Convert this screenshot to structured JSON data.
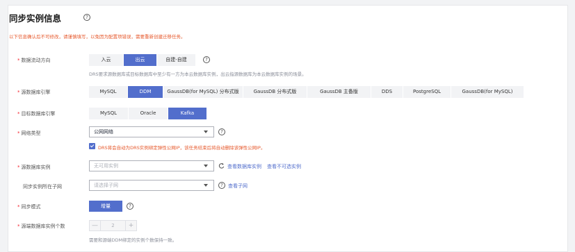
{
  "page": {
    "title": "同步实例信息",
    "warning": "以下信息确认后不可修改，请谨慎填写，以免因为配置项错误，需要重新创建迁移任务。"
  },
  "flow_direction": {
    "label": "数据流动方向",
    "options": [
      "入云",
      "出云",
      "自建-自建"
    ],
    "selected": "出云",
    "hint": "DRS要求源数据库或目标数据库中至少有一方为本云数据库实例，出云指源数据库为本云数据库实例的场景。"
  },
  "source_engine": {
    "label": "源数据库引擎",
    "options": [
      "MySQL",
      "DDM",
      "GaussDB(for MySQL) 分布式版",
      "GaussDB 分布式版",
      "GaussDB 主备版",
      "DDS",
      "PostgreSQL",
      "GaussDB(for MySQL)"
    ],
    "selected": "DDM"
  },
  "target_engine": {
    "label": "目标数据库引擎",
    "options": [
      "MySQL",
      "Oracle",
      "Kafka"
    ],
    "selected": "Kafka"
  },
  "network_type": {
    "label": "网络类型",
    "value": "公网网络",
    "checkbox_label": "DRS将会自动为DRS实例绑定弹性公网IP，该任务结束后将自动删除该弹性公网IP。"
  },
  "source_instance": {
    "label": "源数据库实例",
    "placeholder": "无可用实例",
    "view_link": "查看数据库实例",
    "unselectable_link": "查看不可选实例"
  },
  "subnet": {
    "label": "同步实例所在子网",
    "placeholder": "请选择子网",
    "view_link": "查看子网"
  },
  "sync_mode": {
    "label": "同步模式",
    "value": "增量"
  },
  "instance_count": {
    "label": "源端数据库实例个数",
    "value": "2",
    "minus": "—",
    "plus": "+",
    "hint": "需要和源端DDM绑定的实例个数保持一致。"
  },
  "icons": {
    "help": "?",
    "required": "*"
  },
  "colors": {
    "accent": "#526ecc",
    "warning": "#e6582b",
    "required": "#f5222d"
  }
}
